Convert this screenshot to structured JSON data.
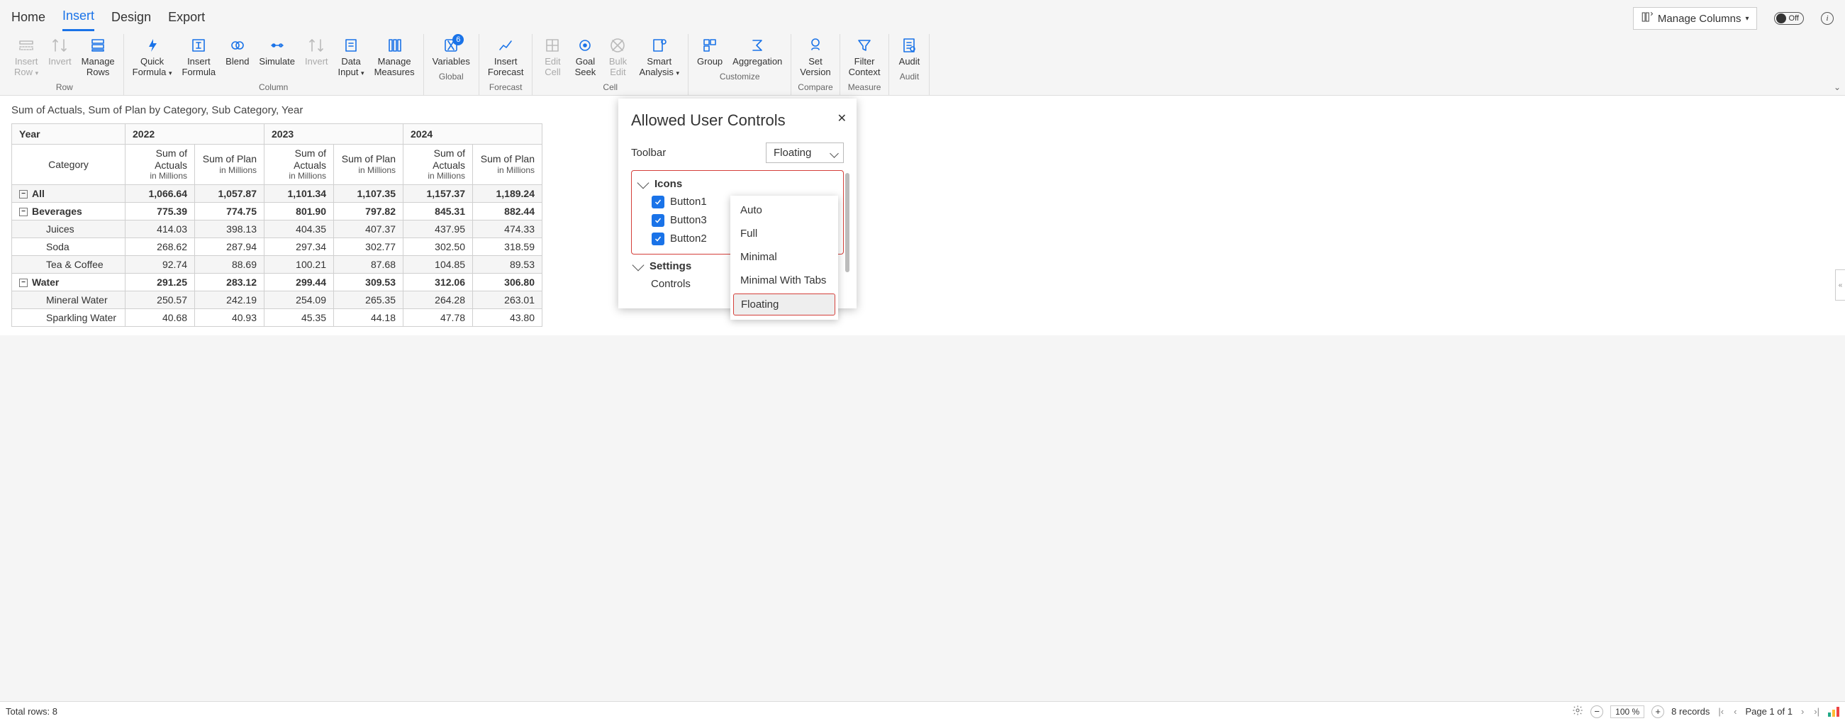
{
  "tabs": {
    "home": "Home",
    "insert": "Insert",
    "design": "Design",
    "export": "Export",
    "active": "insert"
  },
  "toolbar_top": {
    "manage_columns": "Manage Columns",
    "toggle_off": "Off",
    "info": "i"
  },
  "ribbon": {
    "groups": [
      {
        "caption": "Row",
        "buttons": [
          {
            "id": "insert-row",
            "label": "Insert\nRow",
            "disabled": true
          },
          {
            "id": "invert-row",
            "label": "Invert",
            "disabled": true
          },
          {
            "id": "manage-rows",
            "label": "Manage\nRows"
          }
        ]
      },
      {
        "caption": "Column",
        "buttons": [
          {
            "id": "quick-formula",
            "label": "Quick\nFormula"
          },
          {
            "id": "insert-formula",
            "label": "Insert\nFormula"
          },
          {
            "id": "blend",
            "label": "Blend"
          },
          {
            "id": "simulate",
            "label": "Simulate"
          },
          {
            "id": "invert-col",
            "label": "Invert",
            "disabled": true
          },
          {
            "id": "data-input",
            "label": "Data\nInput"
          },
          {
            "id": "manage-measures",
            "label": "Manage\nMeasures"
          }
        ]
      },
      {
        "caption": "Global",
        "buttons": [
          {
            "id": "variables",
            "label": "Variables",
            "badge": "6"
          }
        ]
      },
      {
        "caption": "Forecast",
        "buttons": [
          {
            "id": "insert-forecast",
            "label": "Insert\nForecast"
          }
        ]
      },
      {
        "caption": "Cell",
        "buttons": [
          {
            "id": "edit-cell",
            "label": "Edit\nCell",
            "disabled": true
          },
          {
            "id": "goal-seek",
            "label": "Goal\nSeek"
          },
          {
            "id": "bulk-edit",
            "label": "Bulk\nEdit",
            "disabled": true
          },
          {
            "id": "smart-analysis",
            "label": "Smart\nAnalysis"
          }
        ]
      },
      {
        "caption": "Customize",
        "buttons": [
          {
            "id": "group",
            "label": "Group"
          },
          {
            "id": "aggregation",
            "label": "Aggregation"
          }
        ]
      },
      {
        "caption": "Compare",
        "buttons": [
          {
            "id": "set-version",
            "label": "Set\nVersion"
          }
        ]
      },
      {
        "caption": "Measure",
        "buttons": [
          {
            "id": "filter-context",
            "label": "Filter\nContext"
          }
        ]
      },
      {
        "caption": "Audit",
        "buttons": [
          {
            "id": "audit",
            "label": "Audit"
          }
        ]
      }
    ]
  },
  "pivot": {
    "title": "Sum of Actuals, Sum of Plan by Category, Sub Category, Year",
    "year_label": "Year",
    "category_label": "Category",
    "years": [
      "2022",
      "2023",
      "2024"
    ],
    "measures": [
      {
        "title": "Sum of\nActuals",
        "sub": "in Millions"
      },
      {
        "title": "Sum of Plan",
        "sub": "in Millions"
      }
    ],
    "rows": [
      {
        "label": "All",
        "indent": 0,
        "bold": true,
        "collapsible": true,
        "vals": [
          "1,066.64",
          "1,057.87",
          "1,101.34",
          "1,107.35",
          "1,157.37",
          "1,189.24"
        ]
      },
      {
        "label": "Beverages",
        "indent": 0,
        "bold": true,
        "collapsible": true,
        "vals": [
          "775.39",
          "774.75",
          "801.90",
          "797.82",
          "845.31",
          "882.44"
        ]
      },
      {
        "label": "Juices",
        "indent": 1,
        "vals": [
          "414.03",
          "398.13",
          "404.35",
          "407.37",
          "437.95",
          "474.33"
        ]
      },
      {
        "label": "Soda",
        "indent": 1,
        "vals": [
          "268.62",
          "287.94",
          "297.34",
          "302.77",
          "302.50",
          "318.59"
        ]
      },
      {
        "label": "Tea & Coffee",
        "indent": 1,
        "vals": [
          "92.74",
          "88.69",
          "100.21",
          "87.68",
          "104.85",
          "89.53"
        ]
      },
      {
        "label": "Water",
        "indent": 0,
        "bold": true,
        "collapsible": true,
        "vals": [
          "291.25",
          "283.12",
          "299.44",
          "309.53",
          "312.06",
          "306.80"
        ]
      },
      {
        "label": "Mineral Water",
        "indent": 1,
        "vals": [
          "250.57",
          "242.19",
          "254.09",
          "265.35",
          "264.28",
          "263.01"
        ]
      },
      {
        "label": "Sparkling Water",
        "indent": 1,
        "vals": [
          "40.68",
          "40.93",
          "45.35",
          "44.18",
          "47.78",
          "43.80"
        ]
      }
    ]
  },
  "chart_data": {
    "type": "table",
    "title": "Sum of Actuals, Sum of Plan by Category, Sub Category, Year",
    "columns": [
      "Category",
      "2022 Sum of Actuals (M)",
      "2022 Sum of Plan (M)",
      "2023 Sum of Actuals (M)",
      "2023 Sum of Plan (M)",
      "2024 Sum of Actuals (M)",
      "2024 Sum of Plan (M)"
    ],
    "rows": [
      [
        "All",
        1066.64,
        1057.87,
        1101.34,
        1107.35,
        1157.37,
        1189.24
      ],
      [
        "Beverages",
        775.39,
        774.75,
        801.9,
        797.82,
        845.31,
        882.44
      ],
      [
        "Juices",
        414.03,
        398.13,
        404.35,
        407.37,
        437.95,
        474.33
      ],
      [
        "Soda",
        268.62,
        287.94,
        297.34,
        302.77,
        302.5,
        318.59
      ],
      [
        "Tea & Coffee",
        92.74,
        88.69,
        100.21,
        87.68,
        104.85,
        89.53
      ],
      [
        "Water",
        291.25,
        283.12,
        299.44,
        309.53,
        312.06,
        306.8
      ],
      [
        "Mineral Water",
        250.57,
        242.19,
        254.09,
        265.35,
        264.28,
        263.01
      ],
      [
        "Sparkling Water",
        40.68,
        40.93,
        45.35,
        44.18,
        47.78,
        43.8
      ]
    ]
  },
  "panel": {
    "title": "Allowed User Controls",
    "toolbar_label": "Toolbar",
    "toolbar_value": "Floating",
    "sections": {
      "icons": {
        "label": "Icons",
        "items": [
          "Button1",
          "Button3",
          "Button2"
        ]
      },
      "settings": {
        "label": "Settings"
      },
      "controls": {
        "label": "Controls"
      }
    },
    "dropdown_options": [
      "Auto",
      "Full",
      "Minimal",
      "Minimal With Tabs",
      "Floating"
    ],
    "dropdown_highlight": "Floating"
  },
  "status": {
    "total_rows": "Total rows: 8",
    "zoom": "100 %",
    "records": "8 records",
    "page_label": "Page 1 of 1"
  }
}
